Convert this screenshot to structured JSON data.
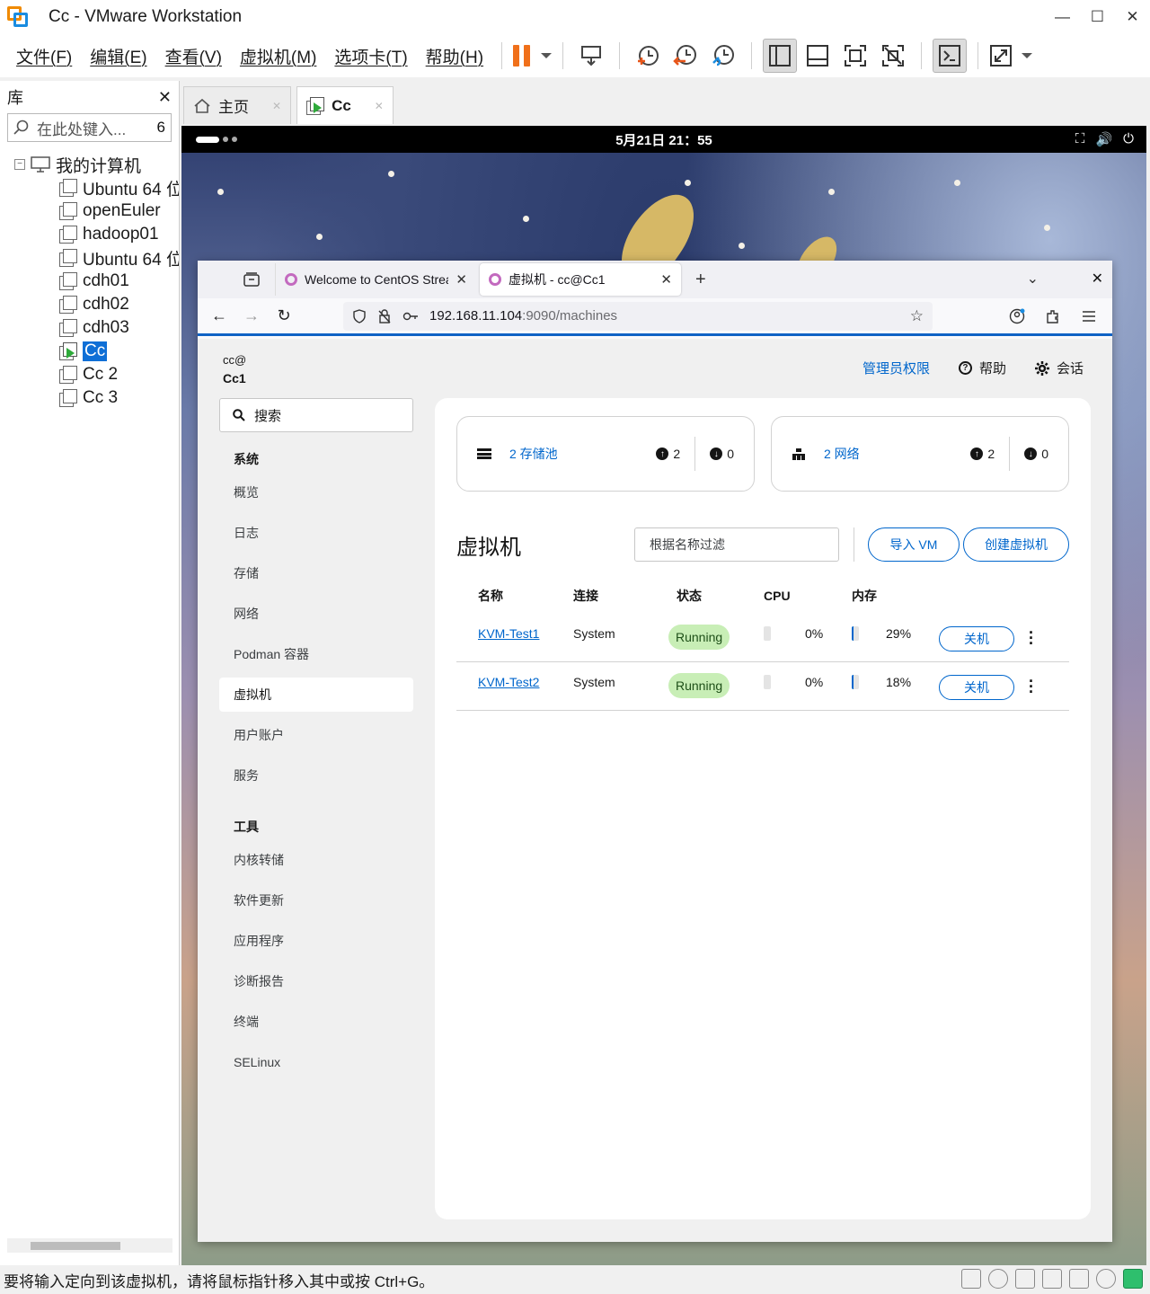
{
  "window": {
    "title": "Cc - VMware Workstation",
    "controls": [
      "—",
      "☐",
      "✕"
    ]
  },
  "menu": [
    "文件(F)",
    "编辑(E)",
    "查看(V)",
    "虚拟机(M)",
    "选项卡(T)",
    "帮助(H)"
  ],
  "library": {
    "title": "库",
    "close": "✕",
    "search_placeholder": "在此处键入...",
    "search_count": "6",
    "root": "我的计算机",
    "root_toggle": "−",
    "items": [
      {
        "label": "Ubuntu 64 位"
      },
      {
        "label": "openEuler"
      },
      {
        "label": "hadoop01"
      },
      {
        "label": "Ubuntu 64 位"
      },
      {
        "label": "cdh01"
      },
      {
        "label": "cdh02"
      },
      {
        "label": "cdh03"
      },
      {
        "label": "Cc"
      },
      {
        "label": "Cc 2"
      },
      {
        "label": "Cc 3"
      }
    ]
  },
  "vm_tabs": [
    {
      "label": "主页",
      "icon": "home-icon"
    },
    {
      "label": "Cc",
      "icon": "vm-running-icon"
    }
  ],
  "gnome": {
    "clock": "5月21日  21：55",
    "tray": [
      "⛶",
      "🔊",
      "⏻"
    ]
  },
  "browser": {
    "tabs": [
      {
        "title": "Welcome to CentOS Strea",
        "close": "✕"
      },
      {
        "title": "虚拟机 - cc@Cc1",
        "close": "✕"
      }
    ],
    "new_tab": "+",
    "list_tabs": "⌄",
    "close_window": "✕",
    "nav": {
      "back": "←",
      "forward": "→",
      "reload": "↻"
    },
    "url_host": "192.168.11.104",
    "url_path": ":9090/machines",
    "star": "☆"
  },
  "cockpit": {
    "user": "cc@",
    "host": "Cc1",
    "admin": "管理员权限",
    "help": "帮助",
    "session": "会话",
    "search": "搜索",
    "nav_sections": {
      "system": "系统",
      "tools": "工具"
    },
    "system_links": [
      "概览",
      "日志",
      "存储",
      "网络",
      "Podman 容器",
      "虚拟机",
      "用户账户",
      "服务"
    ],
    "tool_links": [
      "内核转储",
      "软件更新",
      "应用程序",
      "诊断报告",
      "终端",
      "SELinux"
    ],
    "cards": [
      {
        "label": "2 存储池",
        "up": "2",
        "down": "0"
      },
      {
        "label": "2 网络",
        "up": "2",
        "down": "0"
      }
    ],
    "vms_title": "虚拟机",
    "filter_placeholder": "根据名称过滤",
    "import_btn": "导入 VM",
    "create_btn": "创建虚拟机",
    "columns": [
      "名称",
      "连接",
      "状态",
      "CPU",
      "内存"
    ],
    "vms": [
      {
        "name": "KVM-Test1",
        "connection": "System",
        "state": "Running",
        "cpu": "0%",
        "cpu_value": 0,
        "mem": "29%",
        "mem_value": 29,
        "action": "关机"
      },
      {
        "name": "KVM-Test2",
        "connection": "System",
        "state": "Running",
        "cpu": "0%",
        "cpu_value": 0,
        "mem": "18%",
        "mem_value": 18,
        "action": "关机"
      }
    ]
  },
  "statusbar": {
    "text": "要将输入定向到该虚拟机，请将鼠标指针移入其中或按 Ctrl+G。"
  },
  "colors": {
    "accent": "#0066cc",
    "running_badge": "#c8eeb6",
    "vmware_orange": "#f0701a"
  }
}
